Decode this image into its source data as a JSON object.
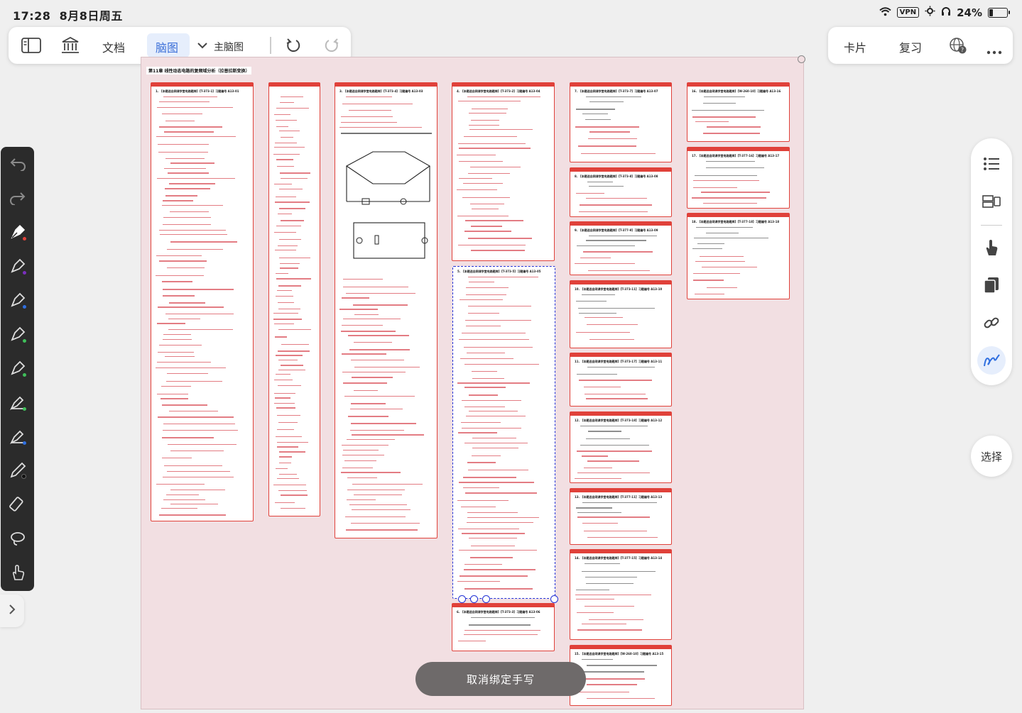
{
  "status_bar": {
    "time": "17:28",
    "date": "8月8日周五",
    "vpn": "VPN",
    "battery": "24%",
    "battery_level": 0.24
  },
  "toolbar": {
    "outline_icon": "sidebar-icon",
    "library_icon": "library-icon",
    "doc_label": "文档",
    "mindmap_label": "脑图",
    "main_map_label": "主脑图",
    "undo_icon": "undo-icon",
    "redo_icon": "redo-icon"
  },
  "right_toolbar": {
    "card_label": "卡片",
    "review_label": "复习",
    "web_icon": "web-help-icon",
    "more_icon": "more-icon"
  },
  "canvas": {
    "chapter_title": "第11章 线性动态电路的复频域分析（拉普拉斯变换）",
    "accent_color": "#e0413a",
    "selection_color": "#2231d6"
  },
  "cards": [
    {
      "title": "1. 【本题选自网课学堂电路题库】【T-373-1】习题编号 A13-01"
    },
    {
      "title": ""
    },
    {
      "title": "3. 【本题选自网课学堂电路题库】【T-373-4】习题编号 A13-03"
    },
    {
      "title": "4. 【本题选自网课学堂电路题库】【T-373-2】习题编号 A13-04"
    },
    {
      "title": "5. 【本题选自网课学堂电路题库】【T-373-5】习题编号 A13-05"
    },
    {
      "title": "6. 【本题选自网课学堂电路题库】【T-373-3】习题编号 A13-06"
    },
    {
      "title": "7. 【本题选自网课学堂电路题库】【T-373-7】习题编号 A13-07"
    },
    {
      "title": "8. 【本题选自网课学堂电路题库】【T-373-8】习题编号 A13-08"
    },
    {
      "title": "9. 【本题选自网课学堂电路题库】【T-377-9】习题编号 A13-09"
    },
    {
      "title": "10. 【本题选自网课学堂电路题库】【T-373-11】习题编号 A13-10"
    },
    {
      "title": "11. 【本题选自网课学堂电路题库】【T-373-17】习题编号 A13-11"
    },
    {
      "title": "12. 【本题选自网课学堂电路题库】【T-373-18】习题编号 A13-12"
    },
    {
      "title": "13. 【本题选自网课学堂电路题库】【T-377-11】习题编号 A13-13"
    },
    {
      "title": "14. 【本题选自网课学堂电路题库】【T-377-15】习题编号 A13-14"
    },
    {
      "title": "15. 【本题选自网课学堂电路题库】【W-260-10】习题编号 A13-15"
    },
    {
      "title": "16. 【本题选自网课学堂电路题库】【W-260-10】习题编号 A13-16"
    },
    {
      "title": "17. 【本题选自网课学堂电路题库】【T-377-16】习题编号 A13-17"
    },
    {
      "title": "18. 【本题选自网课学堂电路题库】【T-377-18】习题编号 A13-18"
    }
  ],
  "palette": {
    "tools": [
      "undo-icon",
      "redo-icon",
      "fountain-pen-icon",
      "pen-icon",
      "pen-icon",
      "pen-icon",
      "pen-icon",
      "highlighter-icon",
      "highlighter-icon",
      "pencil-icon",
      "eraser-icon",
      "lasso-icon",
      "hand-icon"
    ],
    "expand_icon": "chevron-right-icon"
  },
  "side_panel": {
    "icons": [
      "list-icon",
      "layout-icon",
      "hand-pointer-icon",
      "copy-icon",
      "link-icon",
      "handwriting-icon"
    ]
  },
  "select_label": "选择",
  "unbind_label": "取消绑定手写"
}
